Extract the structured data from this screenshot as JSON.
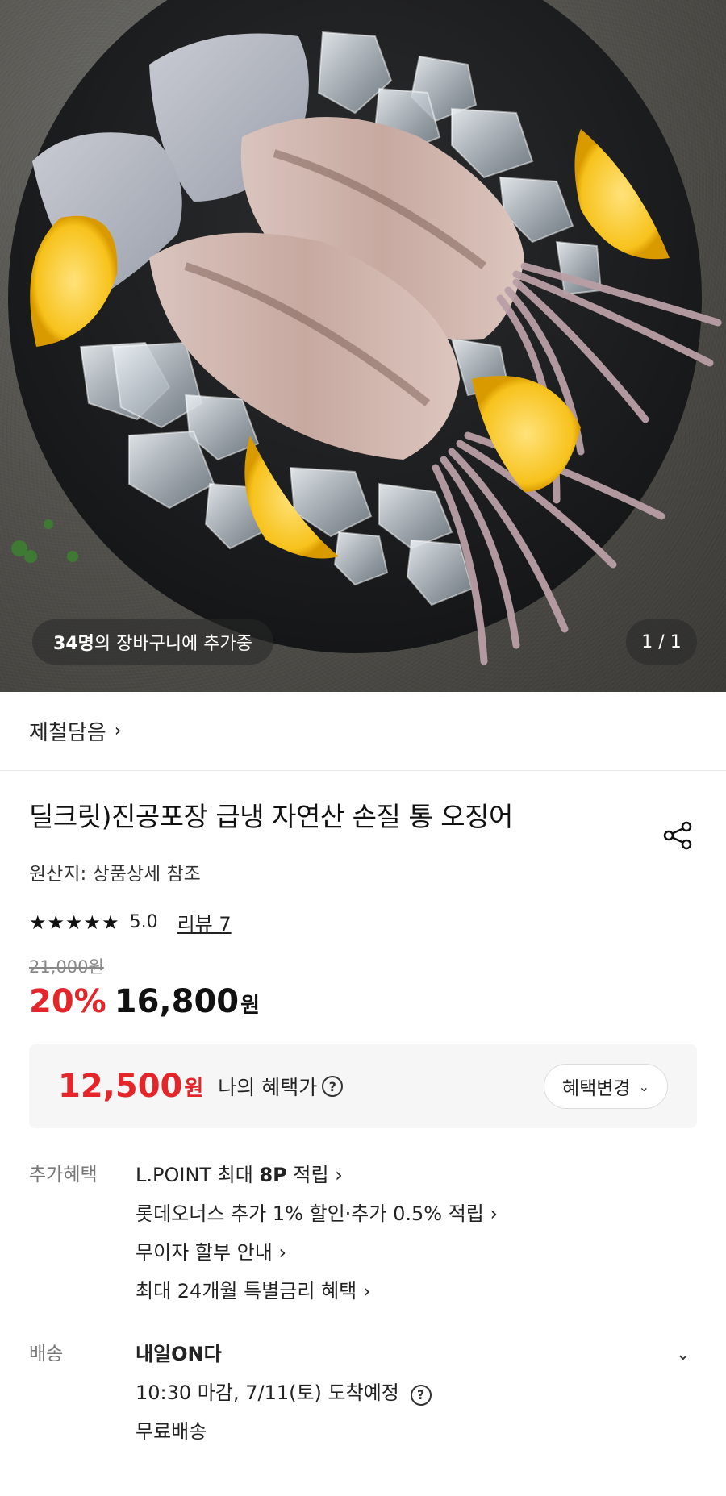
{
  "hero": {
    "basket_count": "34명",
    "basket_text": "의 장바구니에 추가중",
    "image_counter": "1 / 1"
  },
  "brand": {
    "name": "제철담음",
    "chevron": "›"
  },
  "product": {
    "title": "딜크릿)진공포장 급냉 자연산 손질 통 오징어",
    "origin": "원산지: 상품상세 참조",
    "stars": "★★★★★",
    "score": "5.0",
    "review": "리뷰 7",
    "original_price": "21,000원",
    "discount": "20%",
    "price": "16,800",
    "price_unit": "원"
  },
  "benefit": {
    "price": "12,500",
    "unit": "원",
    "label": "나의 혜택가",
    "help": "?",
    "change_label": "혜택변경",
    "change_chevron": "⌄"
  },
  "extra_benefits": {
    "label": "추가혜택",
    "items": [
      {
        "pre": "L.POINT 최대 ",
        "bold": "8P",
        "post": " 적립 ›"
      },
      {
        "pre": "롯데오너스 추가 1% 할인·추가 0.5% 적립 ›",
        "bold": "",
        "post": ""
      },
      {
        "pre": "무이자 할부 안내 ›",
        "bold": "",
        "post": ""
      },
      {
        "pre": "최대 24개월 특별금리 혜택 ›",
        "bold": "",
        "post": ""
      }
    ]
  },
  "shipping": {
    "label": "배송",
    "type": "내일ON다",
    "eta": "10:30 마감, 7/11(토) 도착예정",
    "help": "?",
    "fee": "무료배송",
    "chevron": "⌄"
  },
  "colors": {
    "accent_red": "#e4262b",
    "box_bg": "#f6f6f6",
    "muted": "#777777"
  },
  "icons": [
    "share-icon",
    "chevron-right-icon",
    "chevron-down-icon",
    "question-icon",
    "star-icon"
  ]
}
